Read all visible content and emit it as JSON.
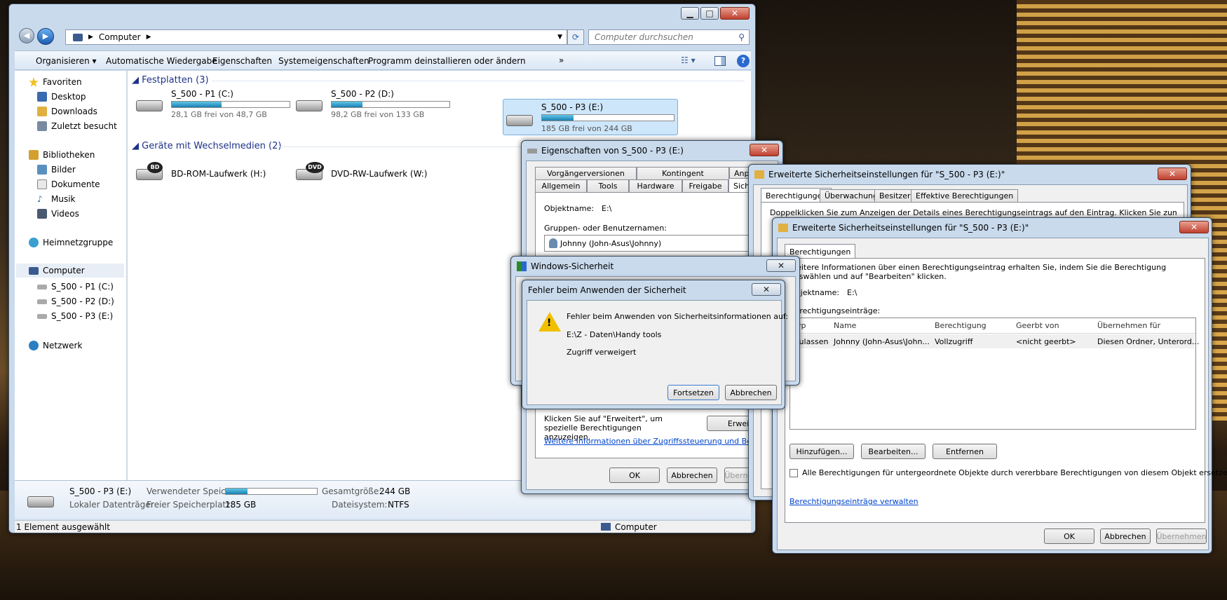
{
  "explorer": {
    "breadcrumb": "Computer",
    "search_placeholder": "Computer durchsuchen",
    "toolbar": [
      "Organisieren ▾",
      "Automatische Wiedergabe",
      "Eigenschaften",
      "Systemeigenschaften",
      "Programm deinstallieren oder ändern",
      "»"
    ],
    "nav": {
      "favorites": "Favoriten",
      "desktop": "Desktop",
      "downloads": "Downloads",
      "recent": "Zuletzt besucht",
      "libraries": "Bibliotheken",
      "pictures": "Bilder",
      "documents": "Dokumente",
      "music": "Musik",
      "videos": "Videos",
      "homegroup": "Heimnetzgruppe",
      "computer": "Computer",
      "c": "S_500 - P1 (C:)",
      "d": "S_500 - P2 (D:)",
      "e": "S_500 - P3 (E:)",
      "network": "Netzwerk"
    },
    "group_disks": "Festplatten (3)",
    "group_removable": "Geräte mit Wechselmedien (2)",
    "drives": [
      {
        "name": "S_500 - P1 (C:)",
        "free": "28,1 GB frei von 48,7 GB",
        "used": 0.42
      },
      {
        "name": "S_500 - P2 (D:)",
        "free": "98,2 GB frei von 133 GB",
        "used": 0.26
      },
      {
        "name": "S_500 - P3 (E:)",
        "free": "185 GB frei von 244 GB",
        "used": 0.24
      }
    ],
    "removable": [
      {
        "name": "BD-ROM-Laufwerk (H:)",
        "badge": "BD"
      },
      {
        "name": "DVD-RW-Laufwerk (W:)",
        "badge": "DVD"
      }
    ],
    "details": {
      "name": "S_500 - P3 (E:)",
      "type": "Lokaler Datenträger",
      "used_label": "Verwendeter Speic...",
      "used": 0.24,
      "free_label": "Freier Speicherplatz:",
      "free": "185 GB",
      "total_label": "Gesamtgröße:",
      "total": "244 GB",
      "fs_label": "Dateisystem:",
      "fs": "NTFS"
    },
    "status": "1 Element ausgewählt",
    "status_right": "Computer"
  },
  "props": {
    "title": "Eigenschaften von S_500 - P3 (E:)",
    "tabs_row1": [
      "Vorgängerversionen",
      "Kontingent",
      "Anpass"
    ],
    "tabs_row2": [
      "Allgemein",
      "Tools",
      "Hardware",
      "Freigabe",
      "Siche"
    ],
    "obj_label": "Objektname:",
    "obj": "E:\\",
    "groups_label": "Gruppen- oder Benutzernamen:",
    "user": "Johnny (John-Asus\\Johnny)",
    "adv_text": "Klicken Sie auf \"Erweitert\", um spezielle Berechtigungen anzuzeigen.",
    "adv_btn": "Erweitert",
    "link": "Weitere Informationen über Zugriffssteuerung und Berechtigungen",
    "ok": "OK",
    "cancel": "Abbrechen",
    "apply": "Übernehmen"
  },
  "adv1": {
    "title": "Erweiterte Sicherheitseinstellungen für \"S_500 - P3 (E:)\"",
    "tabs": [
      "Berechtigungen",
      "Überwachung",
      "Besitzer",
      "Effektive Berechtigungen"
    ],
    "text": "Doppelklicken Sie zum Anzeigen der Details eines Berechtigungseintrags auf den Eintrag. Klicken Sie zum Ändern von"
  },
  "adv2": {
    "title": "Erweiterte Sicherheitseinstellungen für \"S_500 - P3 (E:)\"",
    "tab": "Berechtigungen",
    "info": "Weitere Informationen über einen Berechtigungseintrag erhalten Sie, indem Sie die Berechtigung auswählen und auf \"Bearbeiten\" klicken.",
    "obj_label": "Objektname:",
    "obj": "E:\\",
    "entries_label": "Berechtigungseinträge:",
    "columns": [
      "Typ",
      "Name",
      "Berechtigung",
      "Geerbt von",
      "Übernehmen für"
    ],
    "row": [
      "Zulassen",
      "Johnny (John-Asus\\John...",
      "Vollzugriff",
      "<nicht geerbt>",
      "Diesen Ordner, Unterord..."
    ],
    "add": "Hinzufügen...",
    "edit": "Bearbeiten...",
    "remove": "Entfernen",
    "checkbox": "Alle Berechtigungen für untergeordnete Objekte durch vererbbare Berechtigungen von diesem Objekt ersetzen",
    "manage_link": "Berechtigungseinträge verwalten",
    "ok": "OK",
    "cancel": "Abbrechen",
    "apply": "Übernehmen"
  },
  "winsec": {
    "title": "Windows-Sicherheit"
  },
  "error": {
    "title": "Fehler beim Anwenden der Sicherheit",
    "line1": "Fehler beim Anwenden von Sicherheitsinformationen auf:",
    "path": "E:\\Z - Daten\\Handy tools",
    "line3": "Zugriff verweigert",
    "continue": "Fortsetzen",
    "cancel": "Abbrechen"
  }
}
